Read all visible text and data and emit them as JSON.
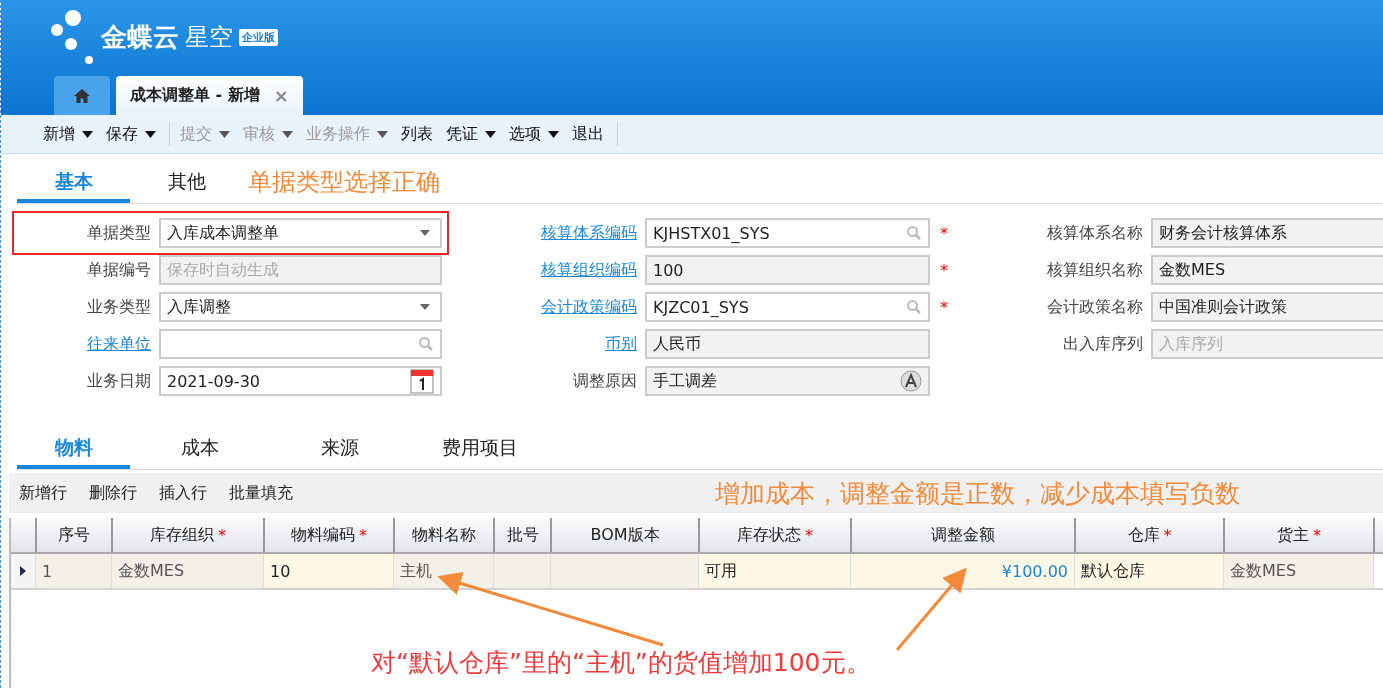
{
  "app": {
    "brand": "金蝶云",
    "product": "星空",
    "edition": "企业版"
  },
  "page_tabs": [
    {
      "kind": "home",
      "selected": false
    },
    {
      "kind": "page",
      "label": "成本调整单 - 新增",
      "close": "×",
      "selected": true
    }
  ],
  "toolbar_groups": [
    [
      {
        "label": "新增",
        "dropdown": true,
        "disabled": false
      },
      {
        "label": "保存",
        "dropdown": true,
        "disabled": false
      }
    ],
    [
      {
        "label": "提交",
        "dropdown": true,
        "disabled": true
      },
      {
        "label": "审核",
        "dropdown": true,
        "disabled": true
      },
      {
        "label": "业务操作",
        "dropdown": true,
        "disabled": true
      },
      {
        "label": "列表",
        "dropdown": false,
        "disabled": false
      },
      {
        "label": "凭证",
        "dropdown": true,
        "disabled": false
      },
      {
        "label": "选项",
        "dropdown": true,
        "disabled": false
      },
      {
        "label": "退出",
        "dropdown": false,
        "disabled": false
      }
    ]
  ],
  "form_tabs": [
    {
      "label": "基本",
      "selected": true
    },
    {
      "label": "其他",
      "selected": false
    }
  ],
  "form_tabs_note": "单据类型选择正确",
  "form_columns": [
    [
      {
        "label": "单据类型",
        "link": false,
        "kind": "dropdown",
        "value": "入库成本调整单",
        "readonly": false,
        "highlighted": true
      },
      {
        "label": "单据编号",
        "link": false,
        "kind": "text",
        "placeholder": "保存时自动生成",
        "readonly": true
      },
      {
        "label": "业务类型",
        "link": false,
        "kind": "dropdown",
        "value": "入库调整",
        "readonly": false
      },
      {
        "label": "往来单位",
        "link": true,
        "kind": "lookup",
        "readonly": false
      },
      {
        "label": "业务日期",
        "link": false,
        "kind": "date",
        "value": "2021-09-30",
        "readonly": false
      }
    ],
    [
      {
        "label": "核算体系编码",
        "link": true,
        "kind": "lookup",
        "value": "KJHSTX01_SYS",
        "readonly": false,
        "required_mark": "*"
      },
      {
        "label": "核算组织编码",
        "link": true,
        "kind": "text",
        "value": "100",
        "readonly": true,
        "required_mark": "*"
      },
      {
        "label": "会计政策编码",
        "link": true,
        "kind": "lookup",
        "value": "KJZC01_SYS",
        "readonly": false,
        "required_mark": "*"
      },
      {
        "label": "币别",
        "link": true,
        "kind": "text",
        "value": "人民币",
        "readonly": true
      },
      {
        "label": "调整原因",
        "link": false,
        "kind": "assist",
        "value": "手工调差",
        "readonly": true
      }
    ],
    [
      {
        "label": "核算体系名称",
        "link": false,
        "kind": "text",
        "value": "财务会计核算体系",
        "readonly": true
      },
      {
        "label": "核算组织名称",
        "link": false,
        "kind": "text",
        "value": "金数MES",
        "readonly": true
      },
      {
        "label": "会计政策名称",
        "link": false,
        "kind": "text",
        "value": "中国准则会计政策",
        "readonly": true
      },
      {
        "label": "出入库序列",
        "link": false,
        "kind": "text",
        "placeholder": "入库序列",
        "readonly": true
      }
    ]
  ],
  "entry_tabs": [
    {
      "label": "物料",
      "selected": true
    },
    {
      "label": "成本",
      "selected": false
    },
    {
      "label": "来源",
      "selected": false
    },
    {
      "label": "费用项目",
      "selected": false
    }
  ],
  "grid_toolbar": [
    "新增行",
    "删除行",
    "插入行",
    "批量填充"
  ],
  "grid_note": "增加成本，调整金额是正数，减少成本填写负数",
  "table": {
    "columns": [
      {
        "label": "序号"
      },
      {
        "label": "库存组织",
        "required_mark": "*"
      },
      {
        "label": "物料编码",
        "required_mark": "*"
      },
      {
        "label": "物料名称"
      },
      {
        "label": "批号"
      },
      {
        "label": "BOM版本"
      },
      {
        "label": "库存状态",
        "required_mark": "*"
      },
      {
        "label": "调整金额"
      },
      {
        "label": "仓库",
        "required_mark": "*"
      },
      {
        "label": "货主",
        "required_mark": "*"
      }
    ],
    "rows": [
      {
        "current": true,
        "cells": [
          {
            "text": "1",
            "kind": "locked"
          },
          {
            "text": "金数MES",
            "kind": "locked"
          },
          {
            "text": "10",
            "kind": "editable"
          },
          {
            "text": "主机",
            "kind": "locked"
          },
          {
            "kind": "locked"
          },
          {
            "kind": "locked"
          },
          {
            "text": "可用",
            "kind": "editable"
          },
          {
            "text": "¥100.00",
            "kind": "amount"
          },
          {
            "text": "默认仓库",
            "kind": "editable"
          },
          {
            "text": "金数MES",
            "kind": "locked"
          }
        ]
      }
    ]
  },
  "callout": "对“默认仓库”里的“主机”的货值增加100元。"
}
